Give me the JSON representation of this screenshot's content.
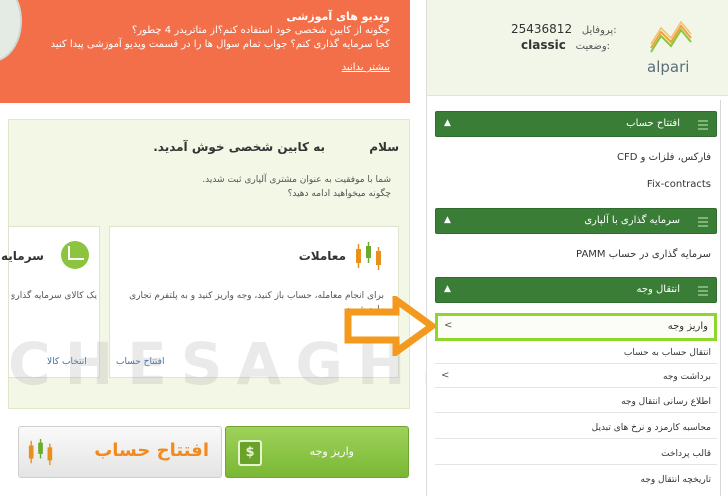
{
  "banner": {
    "title": "ویدیو های آموزشی",
    "line1": "چگونه از کابین شخصی خود استفاده کنم؟از متاتریدر 4 چطور؟",
    "line2": "کجا سرمایه گذاری کنم؟ جواب تمام سوال ها را در قسمت ویدیو آموزشی پیدا کنید",
    "more_link": "بیشتر بدانید"
  },
  "welcome": {
    "hello": "سلام",
    "title": "به کابین شخصی خوش آمدید.",
    "sub1": "شما با موفقیت به عنوان مشتری آلپاری ثبت شدید.",
    "sub2": "چگونه میخواهید ادامه دهید؟"
  },
  "cards": {
    "trade": {
      "title": "معاملات",
      "desc": "برای انجام معامله، حساب باز کنید، وجه واریز کنید و به پلتفرم تجاری وارد شوید.",
      "link": "افتتاح حساب",
      "icon": "candlestick-chart-icon"
    },
    "invest": {
      "title": "سرمایه",
      "desc": "یک کالای سرمایه گذاری انتخاب کنید و واریز انجام دهید.",
      "link": "انتخاب کالا",
      "icon": "pie-chart-icon"
    }
  },
  "buttons": {
    "deposit": "واریز وجه",
    "open_account": "افتتاح حساب"
  },
  "profile": {
    "profile_label": "پروفایل:",
    "profile_value": "25436812",
    "status_label": "وضعیت:",
    "status_value": "classic",
    "logo_text": "alpari"
  },
  "sidebar": {
    "sections": [
      {
        "label": "افتتاح حساب",
        "items": [
          {
            "label": "فارکس، فلزات و CFD"
          },
          {
            "label": "Fix-contracts"
          }
        ]
      },
      {
        "label": "سرمایه گذاری با آلپاری",
        "items": [
          {
            "label": "سرمایه گذاری در حساب PAMM"
          }
        ]
      },
      {
        "label": "انتقال وجه",
        "items": [
          {
            "label": "واریز وجه",
            "highlighted": true
          },
          {
            "label": "انتقال حساب به حساب"
          },
          {
            "label": "برداشت وجه"
          },
          {
            "label": "اطلاع رسانی انتقال وجه"
          },
          {
            "label": "محاسبه کارمزد و نرخ های تبدیل"
          },
          {
            "label": "قالب پرداخت"
          },
          {
            "label": "تاریخچه انتقال وجه"
          }
        ]
      }
    ]
  },
  "watermark": "CHESAGH.co",
  "colors": {
    "banner": "#f36f4a",
    "section_header": "#3a7d36",
    "accent_green": "#8cc43f",
    "highlight_border": "#8ed62a",
    "arrow": "#f39a1e"
  }
}
